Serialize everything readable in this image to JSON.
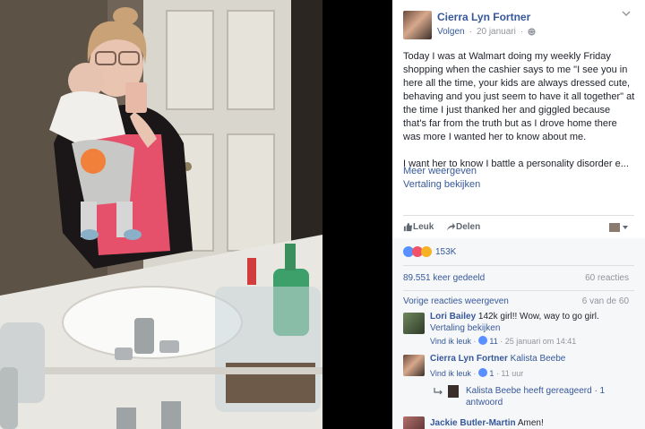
{
  "post": {
    "author": "Cierra Lyn Fortner",
    "follow": "Volgen",
    "date": "20 januari",
    "dot": "·",
    "paragraph1": "Today I was at Walmart doing my weekly Friday shopping when the cashier says to me \"I see you in here all the time, your kids are always dressed cute, behaving and you just seem to have it all together\" at the time I just thanked her and giggled because that's far from the truth but as I drove home there was more I wanted her to know about me.",
    "paragraph2": "I want her to know I battle a personality disorder e...",
    "see_more": "Meer weergeven",
    "translation": "Vertaling bekijken"
  },
  "actions": {
    "like": "Leuk",
    "share": "Delen"
  },
  "stats": {
    "reactions_count": "153K",
    "shares": "89.551 keer gedeeld",
    "comments": "60 reacties",
    "previous": "Vorige reacties weergeven",
    "page_count": "6 van de 60"
  },
  "comments": [
    {
      "name": "Lori Bailey",
      "text": "142k girl!! Wow, way to go girl.",
      "translate": "Vertaling bekijken",
      "like": "Vind ik leuk",
      "likes": "11",
      "time": "25 januari om 14:41"
    },
    {
      "name": "Cierra Lyn Fortner",
      "text": "Kalista Beebe",
      "like": "Vind ik leuk",
      "likes": "1",
      "time": "11 uur",
      "reply": "Kalista Beebe heeft gereageerd · 1 antwoord"
    },
    {
      "name": "Jackie Butler-Martin",
      "text": "Amen!"
    }
  ],
  "colors": {
    "link": "#365899",
    "muted": "#90949c",
    "like_blue": "#5890ff",
    "love_red": "#f25268",
    "haha_yellow": "#f7b125"
  },
  "icons": [
    "chevron-down-icon",
    "globe-icon",
    "thumbs-up-icon",
    "share-arrow-icon",
    "reply-arrow-icon"
  ]
}
